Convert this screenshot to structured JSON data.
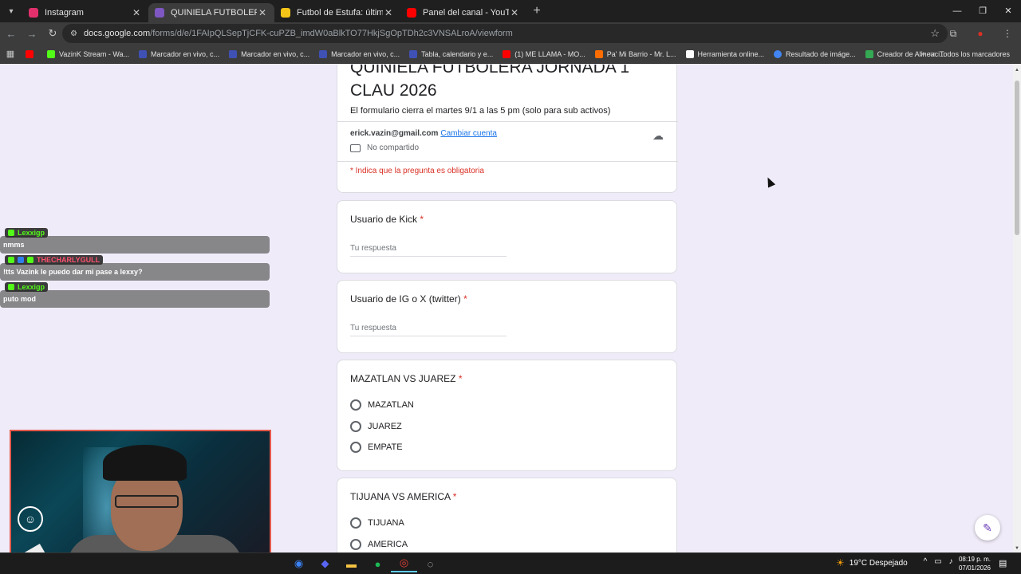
{
  "browser": {
    "tabs": [
      {
        "title": "Instagram",
        "color": "#e1306c",
        "active": false
      },
      {
        "title": "QUINIELA FUTBOLERA JORNAD",
        "color": "#7e57c2",
        "active": true
      },
      {
        "title": "Futbol de Estufa: últimos fichaj",
        "color": "#f5c518",
        "active": false
      },
      {
        "title": "Panel del canal - YouTube Stud",
        "color": "#ff0000",
        "active": false
      }
    ],
    "url_domain": "docs.google.com",
    "url_path": "/forms/d/e/1FAIpQLSepTjCFK-cuPZB_imdW0aBlkTO77HkjSgOpTDh2c3VNSALroA/viewform",
    "bookmarks": [
      {
        "label": "",
        "color": "#ff0000"
      },
      {
        "label": "VazinK Stream - Wa...",
        "color": "#53fc18"
      },
      {
        "label": "Marcador en vivo, c...",
        "color": "#3f51b5"
      },
      {
        "label": "Marcador en vivo, c...",
        "color": "#3f51b5"
      },
      {
        "label": "Marcador en vivo, c...",
        "color": "#3f51b5"
      },
      {
        "label": "Tabla, calendario y e...",
        "color": "#3f51b5"
      },
      {
        "label": "(1) ME LLAMA - MO...",
        "color": "#ff0000"
      },
      {
        "label": "Pa' Mi Barrio - Mr. L...",
        "color": "#ff6d00"
      },
      {
        "label": "Herramienta online...",
        "color": "#ffffff"
      },
      {
        "label": "Resultado de imáge...",
        "color": "#4285f4"
      },
      {
        "label": "Creador de Alineaci...",
        "color": "#34a853"
      }
    ],
    "all_bookmarks": "Todos los marcadores"
  },
  "form": {
    "title": "QUINIELA FUTBOLERA JORNADA 1 CLAU 2026",
    "description": "El formulario cierra el martes 9/1 a las 5 pm (solo para sub activos)",
    "account_email": "erick.vazin@gmail.com",
    "switch_account": "Cambiar cuenta",
    "not_shared": "No compartido",
    "required_note": "* Indica que la pregunta es obligatoria",
    "placeholder": "Tu respuesta",
    "questions": [
      {
        "label": "Usuario de Kick",
        "required": "*"
      },
      {
        "label": "Usuario de IG o X (twitter)",
        "required": "*"
      },
      {
        "label": "MAZATLAN VS JUAREZ",
        "required": "*",
        "options": [
          "MAZATLAN",
          "JUAREZ",
          "EMPATE"
        ]
      },
      {
        "label": "TIJUANA VS AMERICA",
        "required": "*",
        "options": [
          "TIJUANA",
          "AMERICA"
        ]
      }
    ]
  },
  "chat": [
    {
      "user": "Lexxigp",
      "user_color": "#53fc18",
      "message": "nmms"
    },
    {
      "user": "THECHARLYGULL",
      "user_color": "#ff4f6d",
      "message": "!tts Vazink le puedo dar mi pase a lexxy?"
    },
    {
      "user": "Lexxigp",
      "user_color": "#53fc18",
      "message": "puto mod"
    }
  ],
  "taskbar": {
    "weather": "19°C  Despejado",
    "time": "08:19 p. m.",
    "date": "07/01/2026"
  }
}
